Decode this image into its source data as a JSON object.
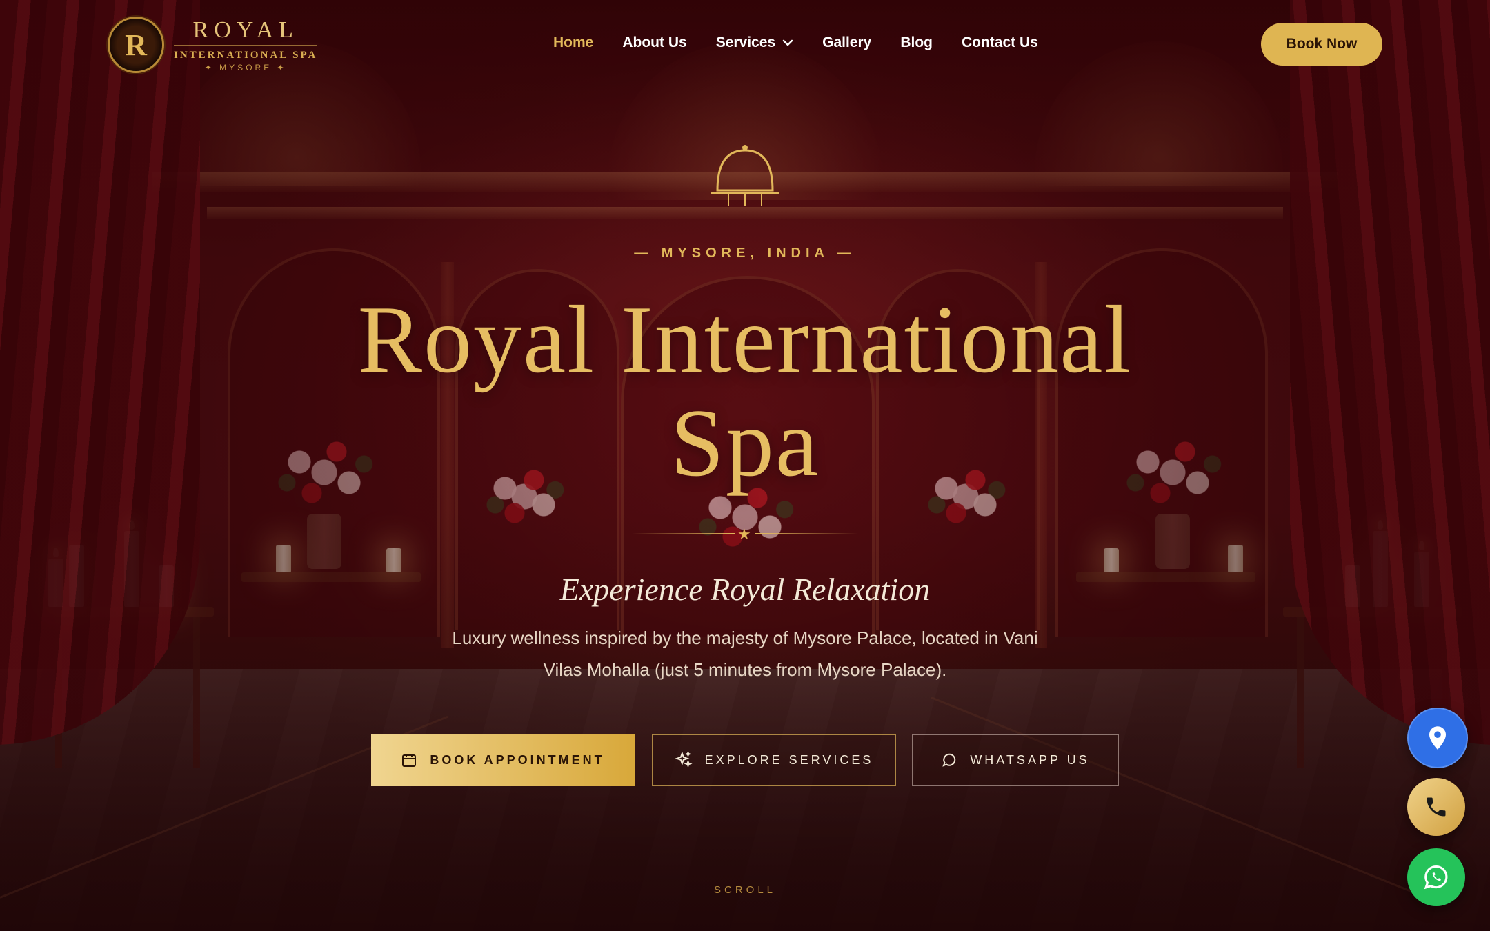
{
  "brand": {
    "emblem_letter": "R",
    "name_top": "ROYAL",
    "name_mid": "INTERNATIONAL SPA",
    "name_bottom": "✦ MYSORE ✦"
  },
  "nav": {
    "items": [
      {
        "label": "Home",
        "active": true
      },
      {
        "label": "About Us"
      },
      {
        "label": "Services",
        "dropdown": true
      },
      {
        "label": "Gallery"
      },
      {
        "label": "Blog"
      },
      {
        "label": "Contact Us"
      }
    ],
    "cta": "Book Now"
  },
  "hero": {
    "kicker": "— MYSORE, INDIA —",
    "title_line1": "Royal International",
    "title_line2": "Spa",
    "subtitle": "Experience Royal Relaxation",
    "description": "Luxury wellness inspired by the majesty of Mysore Palace, located in Vani Vilas Mohalla (just 5 minutes from Mysore Palace).",
    "buttons": {
      "book": "BOOK APPOINTMENT",
      "explore": "EXPLORE SERVICES",
      "whatsapp": "WHATSAPP US"
    },
    "scroll": "SCROLL"
  },
  "floating": {
    "map_icon": "map-pin-icon",
    "phone_icon": "phone-icon",
    "whatsapp_icon": "whatsapp-icon"
  },
  "colors": {
    "gold": "#e2b85a",
    "maroon": "#5a1216",
    "map_blue": "#2f6fe6",
    "whatsapp_green": "#25c35a"
  }
}
